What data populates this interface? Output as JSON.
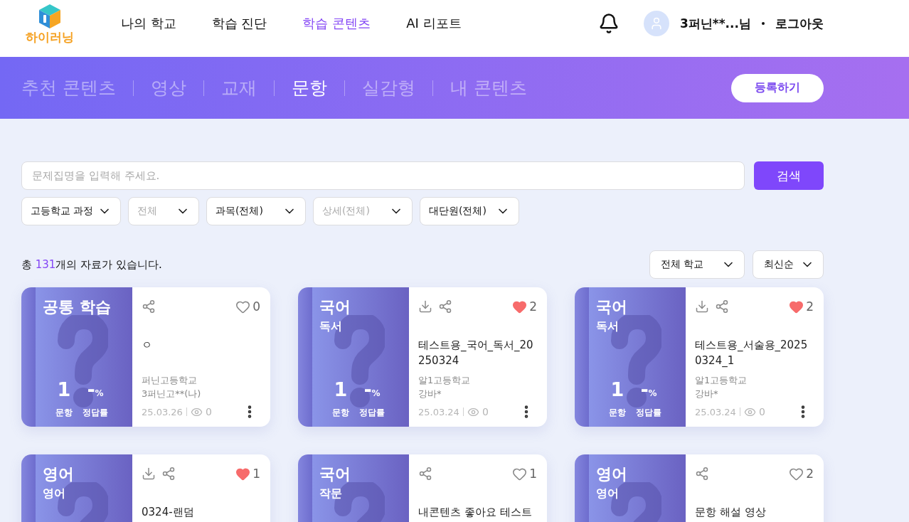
{
  "header": {
    "logo_text": "하이러닝",
    "nav": [
      {
        "label": "나의 학교",
        "selected": false
      },
      {
        "label": "학습 진단",
        "selected": false
      },
      {
        "label": "학습 콘텐츠",
        "selected": true
      },
      {
        "label": "AI 리포트",
        "selected": false
      }
    ],
    "user_name": "3퍼닌**...님",
    "logout": "로그아웃"
  },
  "banner": {
    "tabs": [
      {
        "label": "추천 콘텐츠",
        "selected": false
      },
      {
        "label": "영상",
        "selected": false
      },
      {
        "label": "교재",
        "selected": false
      },
      {
        "label": "문항",
        "selected": true
      },
      {
        "label": "실감형",
        "selected": false
      },
      {
        "label": "내 콘텐츠",
        "selected": false
      }
    ],
    "register_button": "등록하기"
  },
  "search": {
    "placeholder": "문제집명을 입력해 주세요.",
    "button": "검색"
  },
  "filters": [
    {
      "label": "고등학교 과정",
      "disabled": false
    },
    {
      "label": "전체",
      "disabled": true
    },
    {
      "label": "과목(전체)",
      "disabled": false
    },
    {
      "label": "상세(전체)",
      "disabled": true
    },
    {
      "label": "대단원(전체)",
      "disabled": false
    }
  ],
  "result_count": {
    "prefix": "총 ",
    "count": "131",
    "suffix": "개의 자료가 있습니다."
  },
  "sort_filters": [
    {
      "label": "전체 학교"
    },
    {
      "label": "최신순"
    }
  ],
  "cards": [
    {
      "subject": "공통 학습",
      "has_download": false,
      "liked": false,
      "likes": "0",
      "title": "ㅇ",
      "questions": "1",
      "questions_label": "문항",
      "accuracy": "-",
      "accuracy_unit": "%",
      "accuracy_label": "정답률",
      "school": "퍼닌고등학교",
      "author": "3퍼닌고**(나)",
      "date": "25.03.26",
      "views": "0"
    },
    {
      "subject": "국어",
      "topic": "독서",
      "has_download": true,
      "liked": true,
      "likes": "2",
      "title": "테스트용_국어_독서_20250324",
      "questions": "1",
      "questions_label": "문항",
      "accuracy": "-",
      "accuracy_unit": "%",
      "accuracy_label": "정답률",
      "school": "알1고등학교",
      "author": "강바*",
      "date": "25.03.24",
      "views": "0"
    },
    {
      "subject": "국어",
      "topic": "독서",
      "has_download": true,
      "liked": true,
      "likes": "2",
      "title": "테스트용_서술용_20250324_1",
      "questions": "1",
      "questions_label": "문항",
      "accuracy": "-",
      "accuracy_unit": "%",
      "accuracy_label": "정답률",
      "school": "알1고등학교",
      "author": "강바*",
      "date": "25.03.24",
      "views": "0"
    },
    {
      "subject": "영어",
      "topic": "영어",
      "has_download": true,
      "liked": true,
      "likes": "1",
      "title": "0324-랜덤"
    },
    {
      "subject": "국어",
      "topic": "작문",
      "has_download": false,
      "liked": false,
      "likes": "1",
      "title": "내콘텐츠 좋아요 테스트"
    },
    {
      "subject": "영어",
      "topic": "영어",
      "has_download": false,
      "liked": false,
      "likes": "2",
      "title": "문항 해설 영상"
    }
  ]
}
